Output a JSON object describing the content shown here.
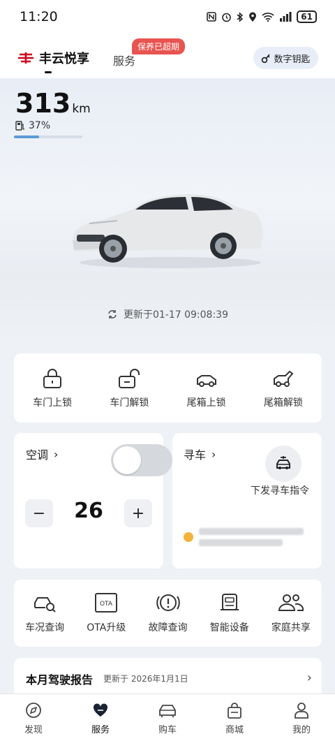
{
  "status_bar": {
    "time": "11:20",
    "icons": [
      "nfc-icon",
      "alarm-icon",
      "bluetooth-icon",
      "location-icon",
      "wifi-icon",
      "signal-icon"
    ],
    "battery": "61"
  },
  "header": {
    "brand_name": "丰云悦享",
    "service_tab": "服务",
    "service_badge": "保养已超期",
    "digital_key": "数字钥匙",
    "brand_color": "#d0021b"
  },
  "vehicle": {
    "range_value": "313",
    "range_unit": "km",
    "fuel_percent": "37%",
    "fuel_level": 0.37,
    "update_text": "更新于01-17 09:08:39"
  },
  "lock_actions": [
    {
      "label": "车门上锁",
      "icon": "lock-icon"
    },
    {
      "label": "车门解锁",
      "icon": "unlock-icon"
    },
    {
      "label": "尾箱上锁",
      "icon": "trunk-lock-icon"
    },
    {
      "label": "尾箱解锁",
      "icon": "trunk-unlock-icon"
    }
  ],
  "ac": {
    "title": "空调",
    "arrow": "›",
    "temperature": "26",
    "minus": "−",
    "plus": "+",
    "enabled": false
  },
  "find_car": {
    "title": "寻车",
    "arrow": "›",
    "action": "下发寻车指令"
  },
  "functions": [
    {
      "label": "车况查询",
      "icon": "car-search-icon"
    },
    {
      "label": "OTA升级",
      "icon": "ota-icon"
    },
    {
      "label": "故障查询",
      "icon": "fault-icon"
    },
    {
      "label": "智能设备",
      "icon": "smart-device-icon"
    },
    {
      "label": "家庭共享",
      "icon": "family-share-icon"
    }
  ],
  "report": {
    "title": "本月驾驶报告",
    "date": "更新于 2026年1月1日",
    "arrow": "›"
  },
  "tabs": [
    {
      "label": "发现",
      "icon": "compass-icon"
    },
    {
      "label": "服务",
      "icon": "heart-icon",
      "active": true
    },
    {
      "label": "购车",
      "icon": "car-icon"
    },
    {
      "label": "商城",
      "icon": "shopping-bag-icon"
    },
    {
      "label": "我的",
      "icon": "profile-icon"
    }
  ]
}
